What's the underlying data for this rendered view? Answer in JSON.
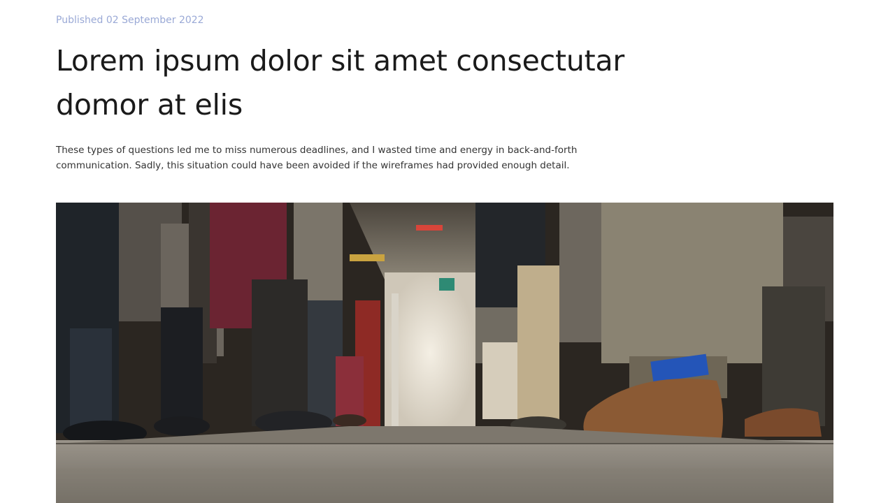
{
  "article": {
    "published": "Published 02 September 2022",
    "title": "Lorem ipsum dolor sit amet consectutar domor at elis",
    "lead": "These types of questions led me to miss numerous deadlines, and I wasted time and energy in back-and-forth communication. Sadly, this situation could have been avoided if the wireframes had provided enough detail."
  },
  "colors": {
    "published_text": "#9aa9d6",
    "title_text": "#1a1a1a",
    "body_text": "#333333",
    "background": "#ffffff"
  }
}
